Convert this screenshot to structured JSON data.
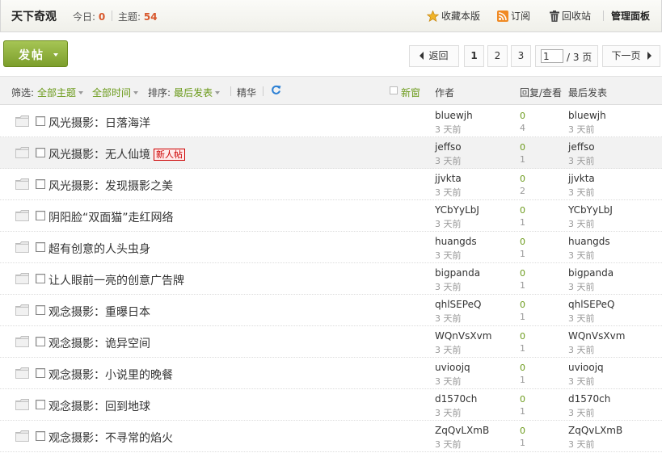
{
  "header": {
    "title": "天下奇观",
    "today_label": "今日: ",
    "today_count": "0",
    "topics_label": "主题: ",
    "topics_count": "54",
    "favorite": "收藏本版",
    "subscribe": "订阅",
    "recycle": "回收站",
    "admin": "管理面板"
  },
  "toolbar": {
    "post_button": "发帖",
    "prev": "返回",
    "pages": [
      "1",
      "2",
      "3"
    ],
    "current_page": "1",
    "page_input": "1",
    "total": "/ 3 页",
    "next": "下一页"
  },
  "filters": {
    "filter_label": "筛选:",
    "all_topics": "全部主题",
    "all_time": "全部时间",
    "sort_label": "排序:",
    "sort_value": "最后发表",
    "digest": "精华",
    "new_window": "新窗",
    "col_author": "作者",
    "col_replies": "回复/查看",
    "col_last": "最后发表"
  },
  "threads": [
    {
      "title": "风光摄影：日落海洋",
      "badge": "",
      "author": "bluewjh",
      "author_time": "3 天前",
      "replies": "0",
      "views": "4",
      "last_user": "bluewjh",
      "last_time": "3 天前"
    },
    {
      "title": "风光摄影：无人仙境",
      "badge": "新人帖",
      "author": "jeffso",
      "author_time": "3 天前",
      "replies": "0",
      "views": "1",
      "last_user": "jeffso",
      "last_time": "3 天前"
    },
    {
      "title": "风光摄影：发现摄影之美",
      "badge": "",
      "author": "jjvkta",
      "author_time": "3 天前",
      "replies": "0",
      "views": "2",
      "last_user": "jjvkta",
      "last_time": "3 天前"
    },
    {
      "title": "阴阳脸“双面猫”走红网络",
      "badge": "",
      "author": "YCbYyLbJ",
      "author_time": "3 天前",
      "replies": "0",
      "views": "1",
      "last_user": "YCbYyLbJ",
      "last_time": "3 天前"
    },
    {
      "title": "超有创意的人头虫身",
      "badge": "",
      "author": "huangds",
      "author_time": "3 天前",
      "replies": "0",
      "views": "1",
      "last_user": "huangds",
      "last_time": "3 天前"
    },
    {
      "title": "让人眼前一亮的创意广告牌",
      "badge": "",
      "author": "bigpanda",
      "author_time": "3 天前",
      "replies": "0",
      "views": "1",
      "last_user": "bigpanda",
      "last_time": "3 天前"
    },
    {
      "title": "观念摄影：重曝日本",
      "badge": "",
      "author": "qhlSEPeQ",
      "author_time": "3 天前",
      "replies": "0",
      "views": "1",
      "last_user": "qhlSEPeQ",
      "last_time": "3 天前"
    },
    {
      "title": "观念摄影：诡异空间",
      "badge": "",
      "author": "WQnVsXvm",
      "author_time": "3 天前",
      "replies": "0",
      "views": "1",
      "last_user": "WQnVsXvm",
      "last_time": "3 天前"
    },
    {
      "title": "观念摄影：小说里的晚餐",
      "badge": "",
      "author": "uvioojq",
      "author_time": "3 天前",
      "replies": "0",
      "views": "1",
      "last_user": "uvioojq",
      "last_time": "3 天前"
    },
    {
      "title": "观念摄影：回到地球",
      "badge": "",
      "author": "d1570ch",
      "author_time": "3 天前",
      "replies": "0",
      "views": "1",
      "last_user": "d1570ch",
      "last_time": "3 天前"
    },
    {
      "title": "观念摄影：不寻常的焰火",
      "badge": "",
      "author": "ZqQvLXmB",
      "author_time": "3 天前",
      "replies": "0",
      "views": "1",
      "last_user": "ZqQvLXmB",
      "last_time": "3 天前"
    }
  ]
}
